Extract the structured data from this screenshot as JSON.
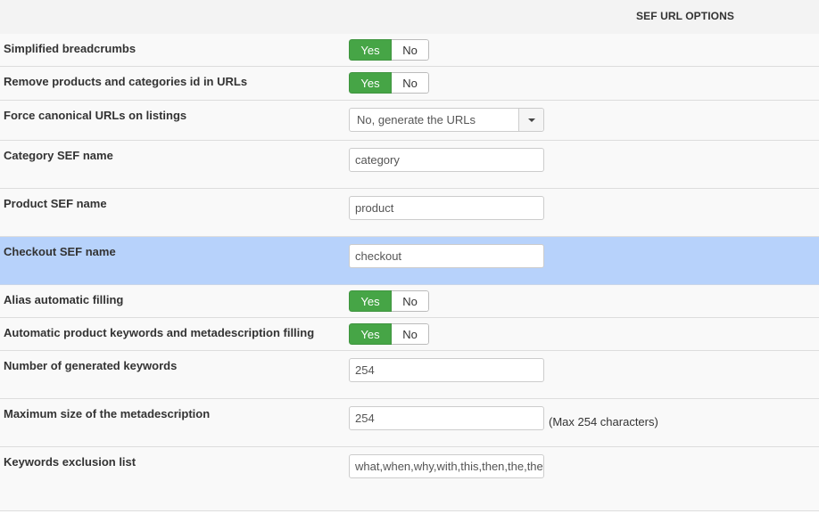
{
  "header": {
    "title": "SEF URL OPTIONS"
  },
  "toggle_labels": {
    "yes": "Yes",
    "no": "No"
  },
  "colors": {
    "yes_active": "#46a546",
    "row_highlight": "#b7d2fb"
  },
  "rows": {
    "simplified_breadcrumbs": {
      "label": "Simplified breadcrumbs",
      "value": "Yes"
    },
    "remove_ids": {
      "label": "Remove products and categories id in URLs",
      "value": "Yes"
    },
    "force_canonical": {
      "label": "Force canonical URLs on listings",
      "selected": "No, generate the URLs",
      "icon": "chevron-down-icon"
    },
    "category_sef": {
      "label": "Category SEF name",
      "value": "category"
    },
    "product_sef": {
      "label": "Product SEF name",
      "value": "product"
    },
    "checkout_sef": {
      "label": "Checkout SEF name",
      "value": "checkout"
    },
    "alias_filling": {
      "label": "Alias automatic filling",
      "value": "Yes"
    },
    "keywords_filling": {
      "label": "Automatic product keywords and metadescription filling",
      "value": "Yes"
    },
    "generated_keywords": {
      "label": "Number of generated keywords",
      "value": "254"
    },
    "max_metadescription": {
      "label": "Maximum size of the metadescription",
      "value": "254",
      "hint": "(Max 254 characters)"
    },
    "keywords_exclusion": {
      "label": "Keywords exclusion list",
      "value": "what,when,why,with,this,then,the,they"
    }
  }
}
